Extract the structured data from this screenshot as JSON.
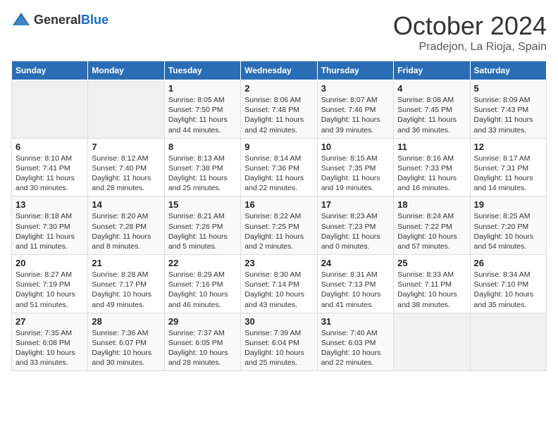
{
  "logo": {
    "text_general": "General",
    "text_blue": "Blue"
  },
  "title": "October 2024",
  "location": "Pradejon, La Rioja, Spain",
  "days_of_week": [
    "Sunday",
    "Monday",
    "Tuesday",
    "Wednesday",
    "Thursday",
    "Friday",
    "Saturday"
  ],
  "weeks": [
    [
      {
        "day": "",
        "info": ""
      },
      {
        "day": "",
        "info": ""
      },
      {
        "day": "1",
        "info": "Sunrise: 8:05 AM\nSunset: 7:50 PM\nDaylight: 11 hours and 44 minutes."
      },
      {
        "day": "2",
        "info": "Sunrise: 8:06 AM\nSunset: 7:48 PM\nDaylight: 11 hours and 42 minutes."
      },
      {
        "day": "3",
        "info": "Sunrise: 8:07 AM\nSunset: 7:46 PM\nDaylight: 11 hours and 39 minutes."
      },
      {
        "day": "4",
        "info": "Sunrise: 8:08 AM\nSunset: 7:45 PM\nDaylight: 11 hours and 36 minutes."
      },
      {
        "day": "5",
        "info": "Sunrise: 8:09 AM\nSunset: 7:43 PM\nDaylight: 11 hours and 33 minutes."
      }
    ],
    [
      {
        "day": "6",
        "info": "Sunrise: 8:10 AM\nSunset: 7:41 PM\nDaylight: 11 hours and 30 minutes."
      },
      {
        "day": "7",
        "info": "Sunrise: 8:12 AM\nSunset: 7:40 PM\nDaylight: 11 hours and 28 minutes."
      },
      {
        "day": "8",
        "info": "Sunrise: 8:13 AM\nSunset: 7:38 PM\nDaylight: 11 hours and 25 minutes."
      },
      {
        "day": "9",
        "info": "Sunrise: 8:14 AM\nSunset: 7:36 PM\nDaylight: 11 hours and 22 minutes."
      },
      {
        "day": "10",
        "info": "Sunrise: 8:15 AM\nSunset: 7:35 PM\nDaylight: 11 hours and 19 minutes."
      },
      {
        "day": "11",
        "info": "Sunrise: 8:16 AM\nSunset: 7:33 PM\nDaylight: 11 hours and 16 minutes."
      },
      {
        "day": "12",
        "info": "Sunrise: 8:17 AM\nSunset: 7:31 PM\nDaylight: 11 hours and 14 minutes."
      }
    ],
    [
      {
        "day": "13",
        "info": "Sunrise: 8:18 AM\nSunset: 7:30 PM\nDaylight: 11 hours and 11 minutes."
      },
      {
        "day": "14",
        "info": "Sunrise: 8:20 AM\nSunset: 7:28 PM\nDaylight: 11 hours and 8 minutes."
      },
      {
        "day": "15",
        "info": "Sunrise: 8:21 AM\nSunset: 7:26 PM\nDaylight: 11 hours and 5 minutes."
      },
      {
        "day": "16",
        "info": "Sunrise: 8:22 AM\nSunset: 7:25 PM\nDaylight: 11 hours and 2 minutes."
      },
      {
        "day": "17",
        "info": "Sunrise: 8:23 AM\nSunset: 7:23 PM\nDaylight: 11 hours and 0 minutes."
      },
      {
        "day": "18",
        "info": "Sunrise: 8:24 AM\nSunset: 7:22 PM\nDaylight: 10 hours and 57 minutes."
      },
      {
        "day": "19",
        "info": "Sunrise: 8:25 AM\nSunset: 7:20 PM\nDaylight: 10 hours and 54 minutes."
      }
    ],
    [
      {
        "day": "20",
        "info": "Sunrise: 8:27 AM\nSunset: 7:19 PM\nDaylight: 10 hours and 51 minutes."
      },
      {
        "day": "21",
        "info": "Sunrise: 8:28 AM\nSunset: 7:17 PM\nDaylight: 10 hours and 49 minutes."
      },
      {
        "day": "22",
        "info": "Sunrise: 8:29 AM\nSunset: 7:16 PM\nDaylight: 10 hours and 46 minutes."
      },
      {
        "day": "23",
        "info": "Sunrise: 8:30 AM\nSunset: 7:14 PM\nDaylight: 10 hours and 43 minutes."
      },
      {
        "day": "24",
        "info": "Sunrise: 8:31 AM\nSunset: 7:13 PM\nDaylight: 10 hours and 41 minutes."
      },
      {
        "day": "25",
        "info": "Sunrise: 8:33 AM\nSunset: 7:11 PM\nDaylight: 10 hours and 38 minutes."
      },
      {
        "day": "26",
        "info": "Sunrise: 8:34 AM\nSunset: 7:10 PM\nDaylight: 10 hours and 35 minutes."
      }
    ],
    [
      {
        "day": "27",
        "info": "Sunrise: 7:35 AM\nSunset: 6:08 PM\nDaylight: 10 hours and 33 minutes."
      },
      {
        "day": "28",
        "info": "Sunrise: 7:36 AM\nSunset: 6:07 PM\nDaylight: 10 hours and 30 minutes."
      },
      {
        "day": "29",
        "info": "Sunrise: 7:37 AM\nSunset: 6:05 PM\nDaylight: 10 hours and 28 minutes."
      },
      {
        "day": "30",
        "info": "Sunrise: 7:39 AM\nSunset: 6:04 PM\nDaylight: 10 hours and 25 minutes."
      },
      {
        "day": "31",
        "info": "Sunrise: 7:40 AM\nSunset: 6:03 PM\nDaylight: 10 hours and 22 minutes."
      },
      {
        "day": "",
        "info": ""
      },
      {
        "day": "",
        "info": ""
      }
    ]
  ]
}
